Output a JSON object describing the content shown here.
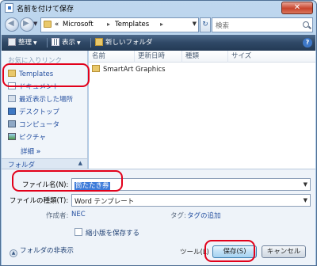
{
  "titlebar": {
    "title": "名前を付けて保存",
    "close_label": "✕"
  },
  "address": {
    "chevron": "«",
    "crumbs": [
      "Microsoft",
      "Templates"
    ],
    "separator": "▸",
    "search_placeholder": "検索"
  },
  "toolbar": {
    "organize": "整理",
    "views": "表示",
    "new_folder": "新しいフォルダ",
    "help": "?"
  },
  "left_pane": {
    "header": "お気に入りリンク",
    "items": [
      {
        "label": "Templates",
        "icon": "folder-icon"
      },
      {
        "label": "ドキュメント",
        "icon": "documents-icon"
      },
      {
        "label": "最近表示した場所",
        "icon": "recent-places-icon"
      },
      {
        "label": "デスクトップ",
        "icon": "desktop-icon"
      },
      {
        "label": "コンピュータ",
        "icon": "computer-icon"
      },
      {
        "label": "ピクチャ",
        "icon": "pictures-icon"
      }
    ],
    "more": "詳細",
    "more_arrows": "»",
    "footer": "フォルダ",
    "footer_arrow": "▲"
  },
  "file_list": {
    "columns": [
      "名前",
      "更新日時",
      "種類",
      "サイズ"
    ],
    "rows": [
      {
        "name": "SmartArt Graphics"
      }
    ]
  },
  "form": {
    "filename_label": "ファイル名(N):",
    "filename_value": "筒たたき券",
    "filetype_label": "ファイルの種類(T):",
    "filetype_value": "Word テンプレート",
    "author_label": "作成者:",
    "author_value": "NEC",
    "tags_label": "タグ:",
    "tags_value": "タグの追加",
    "thumbnail_label": "縮小版を保存する",
    "hide_folders": "フォルダの非表示",
    "tools": "ツール(L)",
    "save": "保存(S)",
    "cancel": "キャンセル"
  },
  "colors": {
    "highlight": "#e2001a",
    "accent": "#3d7bd9",
    "link": "#2550a0"
  }
}
